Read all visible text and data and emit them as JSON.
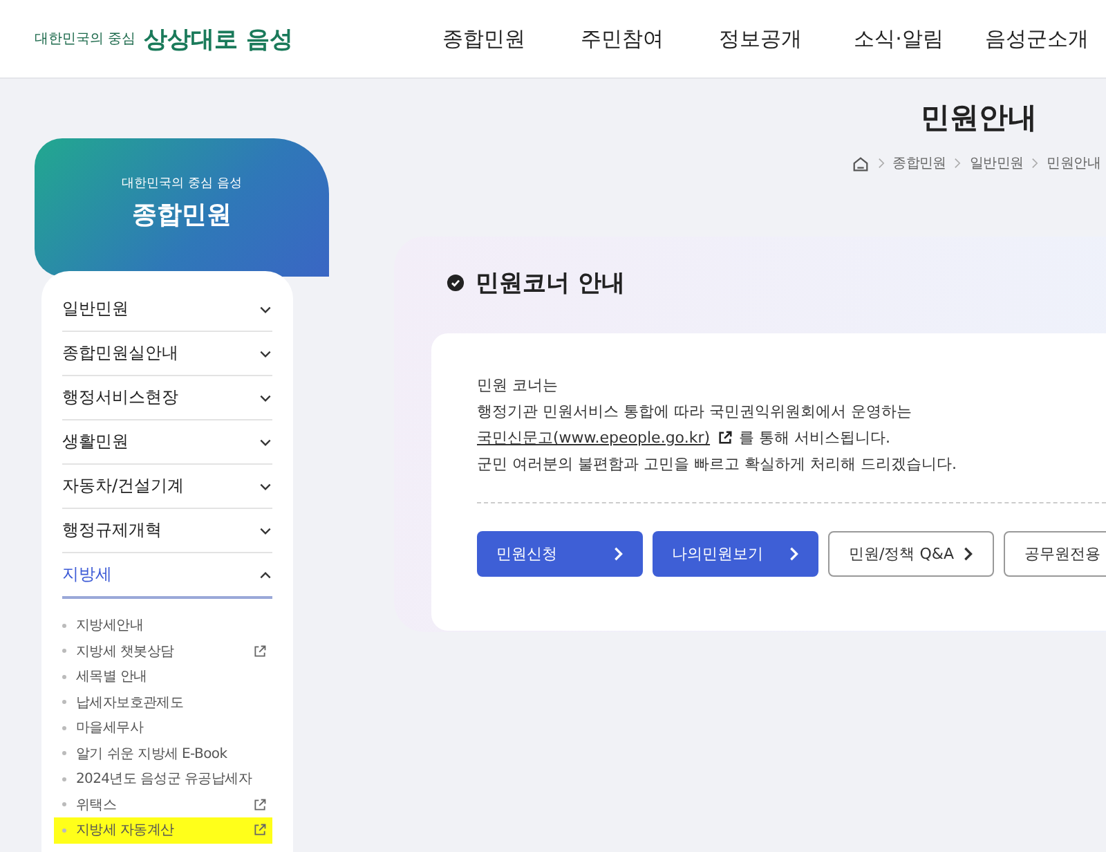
{
  "header": {
    "logo_tagline": "대한민국의 중심",
    "logo_text": "상상대로 음성",
    "nav": [
      "종합민원",
      "주민참여",
      "정보공개",
      "소식·알림",
      "음성군소개"
    ]
  },
  "page_title": "민원안내",
  "breadcrumb": [
    "종합민원",
    "일반민원",
    "민원안내"
  ],
  "sidebar": {
    "subtitle": "대한민국의 중심 음성",
    "title": "종합민원",
    "items": [
      {
        "label": "일반민원",
        "expanded": false,
        "selected": false
      },
      {
        "label": "종합민원실안내",
        "expanded": false,
        "selected": false
      },
      {
        "label": "행정서비스현장",
        "expanded": false,
        "selected": false
      },
      {
        "label": "생활민원",
        "expanded": false,
        "selected": false
      },
      {
        "label": "자동차/건설기계",
        "expanded": false,
        "selected": false
      },
      {
        "label": "행정규제개혁",
        "expanded": false,
        "selected": false
      },
      {
        "label": "지방세",
        "expanded": true,
        "selected": true,
        "children": [
          {
            "label": "지방세안내",
            "external": false,
            "highlighted": false
          },
          {
            "label": "지방세 챗봇상담",
            "external": true,
            "highlighted": false
          },
          {
            "label": "세목별 안내",
            "external": false,
            "highlighted": false
          },
          {
            "label": "납세자보호관제도",
            "external": false,
            "highlighted": false
          },
          {
            "label": "마을세무사",
            "external": false,
            "highlighted": false
          },
          {
            "label": "알기 쉬운 지방세 E-Book",
            "external": false,
            "highlighted": false
          },
          {
            "label": "2024년도 음성군 유공납세자",
            "external": false,
            "highlighted": false
          },
          {
            "label": "위택스",
            "external": true,
            "highlighted": false
          },
          {
            "label": "지방세 자동계산",
            "external": true,
            "highlighted": true
          }
        ]
      }
    ]
  },
  "section": {
    "title": "민원코너 안내",
    "lines": [
      "민원 코너는",
      "행정기관 민원서비스 통합에 따라 국민권익위원회에서 운영하는"
    ],
    "link": "국민신문고(www.epeople.go.kr)",
    "link_suffix": "를 통해 서비스됩니다.",
    "last_line": "군민 여러분의 불편함과 고민을 빠르고 확실하게 처리해 드리겠습니다.",
    "buttons": [
      {
        "label": "민원신청",
        "kind": "primary"
      },
      {
        "label": "나의민원보기",
        "kind": "primary"
      },
      {
        "label": "민원/정책 Q&A",
        "kind": "outline"
      },
      {
        "label": "공무원전용",
        "kind": "outline"
      }
    ]
  }
}
